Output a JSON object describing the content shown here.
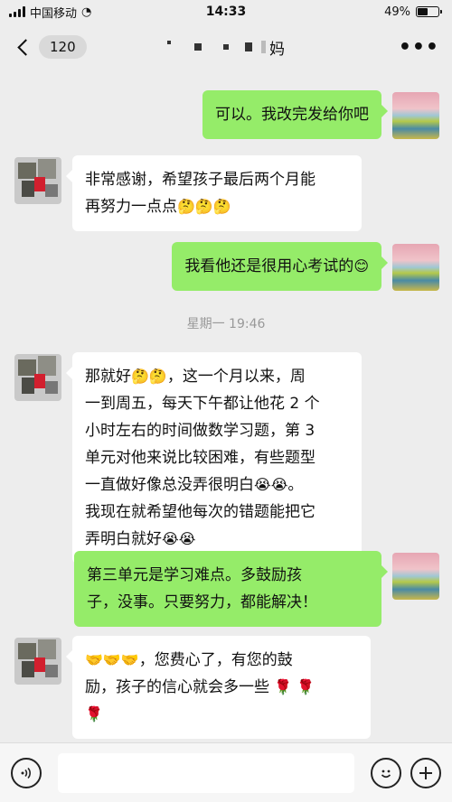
{
  "status_bar": {
    "carrier": "中国移动",
    "time": "14:33",
    "battery": "49%",
    "battery_level": 0.49
  },
  "nav": {
    "unread_count": "120",
    "title_suffix": "妈"
  },
  "messages": [
    {
      "side": "out",
      "text": "可以。我改完发给你吧"
    },
    {
      "side": "in",
      "lines": [
        "非常感谢，希望孩子最后两个月能",
        "再努力一点点"
      ],
      "emoji": "🤔🤔🤔"
    },
    {
      "side": "out",
      "text": "我看他还是很用心考试的",
      "emoji": "😊"
    },
    {
      "side": "in",
      "lines": [
        "那就好",
        "，这一个月以来，周",
        "一到周五，每天下午都让他花 2 个",
        "小时左右的时间做数学习题，第 3",
        "单元对他来说比较困难，有些题型",
        "一直做好像总没弄很明白",
        "。",
        "我现在就希望他每次的错题能把它",
        "弄明白就好"
      ],
      "emoji_a": "🤔🤔",
      "emoji_b": "😭😭",
      "emoji_c": "😭😭"
    },
    {
      "side": "out",
      "lines": [
        "第三单元是学习难点。多鼓励孩",
        "子，没事。只要努力，都能解决！"
      ]
    },
    {
      "side": "in",
      "lines": [
        "，您费心了，有您的鼓",
        "励，孩子的信心就会多一些"
      ],
      "emoji_a": "🤝🤝🤝",
      "emoji_b": "🌹 🌹",
      "emoji_c": "🌹"
    }
  ],
  "timestamp": "星期一 19:46",
  "icons": {
    "back": "chevron-left-icon",
    "more": "more-icon",
    "voice": "voice-icon",
    "emoji": "smile-icon",
    "add": "plus-icon"
  }
}
